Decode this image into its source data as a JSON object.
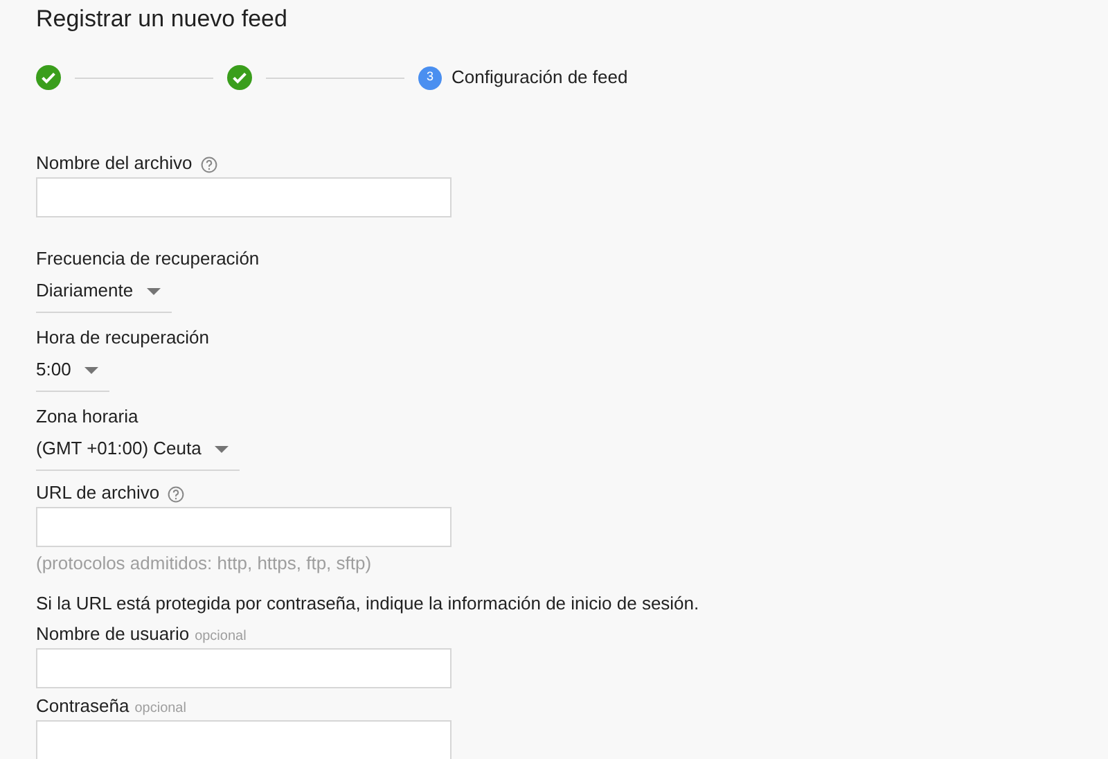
{
  "title": "Registrar un nuevo feed",
  "steps": [
    {
      "kind": "done"
    },
    {
      "kind": "done"
    },
    {
      "kind": "current",
      "number": "3",
      "label": "Configuración de feed"
    }
  ],
  "fields": [
    {
      "kind": "text_input",
      "label": "Nombre del archivo",
      "help": true
    },
    {
      "kind": "dropdown",
      "label": "Frecuencia de recuperación",
      "value": "Diariamente"
    },
    {
      "kind": "dropdown",
      "label": "Hora de recuperación",
      "value": "5:00"
    },
    {
      "kind": "dropdown",
      "label": "Zona horaria",
      "value": "(GMT +01:00) Ceuta"
    },
    {
      "kind": "text_input",
      "label": "URL de archivo",
      "help": true
    },
    {
      "kind": "hint",
      "text": "(protocolos admitidos: http, https, ftp, sftp)"
    },
    {
      "kind": "note",
      "text": "Si la URL está protegida por contraseña, indique la información de inicio de sesión."
    },
    {
      "kind": "text_input",
      "label": "Nombre de usuario",
      "help": false,
      "optional": "opcional"
    },
    {
      "kind": "text_input",
      "label": "Contraseña",
      "help": false,
      "optional": "opcional"
    }
  ]
}
